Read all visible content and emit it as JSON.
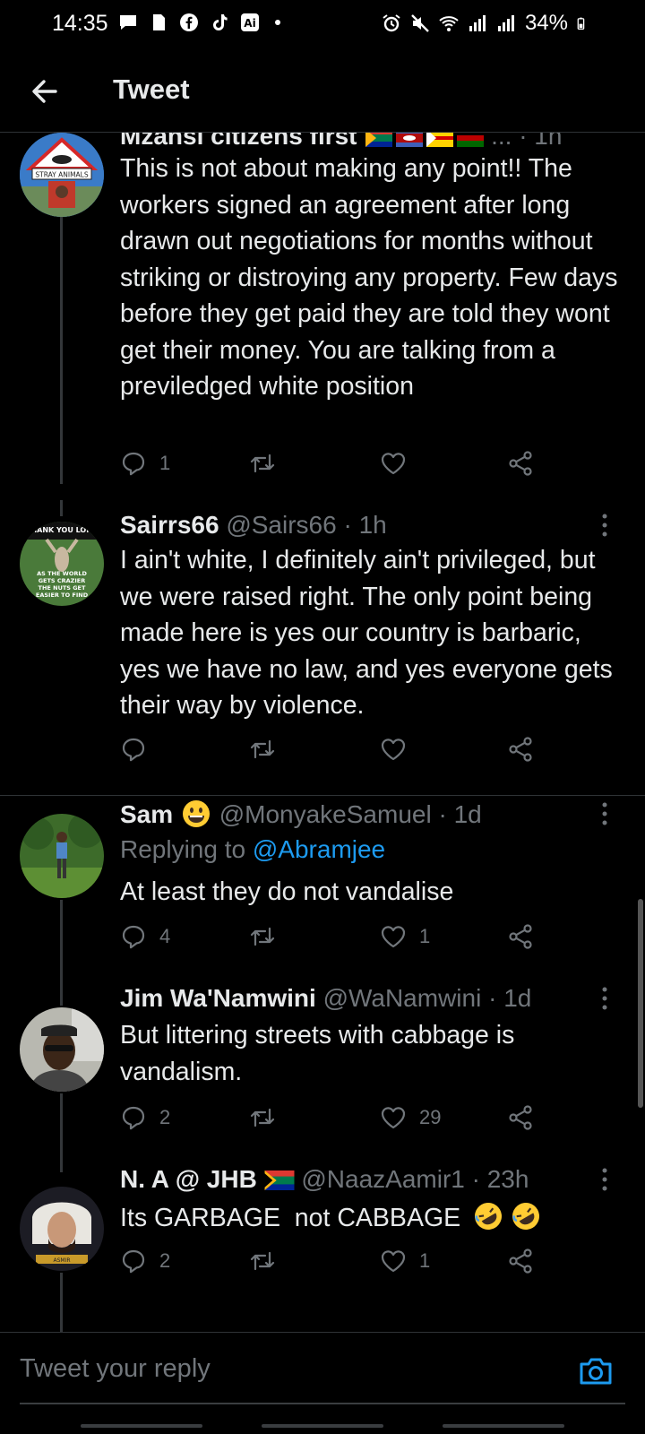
{
  "status_bar": {
    "time": "14:35",
    "battery": "34%"
  },
  "header": {
    "title": "Tweet"
  },
  "tweets": [
    {
      "name": "Mzansi citizens first",
      "meta": "... · 1h",
      "body": "This is not about making any point!! The workers signed an agreement after long drawn out negotiations for months without striking or distroying any property. Few days before they get paid they are told they wont get their money. You are talking from a previledged white position",
      "replies": "1",
      "retweets": "",
      "likes": ""
    },
    {
      "name": "Sairrs66",
      "handle": "@Sairs66",
      "time": "· 1h",
      "body": "I ain't white, I definitely ain't privileged, but we were raised right. The only point being made here is yes our country is barbaric, yes we have no law, and yes everyone gets their way by violence.",
      "replies": "",
      "retweets": "",
      "likes": ""
    },
    {
      "name": "Sam",
      "handle": "@MonyakeSamuel",
      "time": "· 1d",
      "replying_prefix": "Replying to",
      "replying_to": "@Abramjee",
      "body": "At least they do not vandalise",
      "replies": "4",
      "retweets": "",
      "likes": "1"
    },
    {
      "name": "Jim Wa'Namwini",
      "handle": "@WaNamwini",
      "time": "· 1d",
      "body": "But littering streets with cabbage is vandalism.",
      "replies": "2",
      "retweets": "",
      "likes": "29"
    },
    {
      "name": "N. A @ JHB",
      "handle": "@NaazAamir1",
      "time": "· 23h",
      "body": "Its GARBAGE  not CABBAGE",
      "replies": "2",
      "retweets": "",
      "likes": "1"
    }
  ],
  "avatar_texts": {
    "stray_animals": "STRAY ANIMALS",
    "thank_you": "THANK YOU LORD",
    "world_text": "AS THE WORLD GETS CRAZIER THE NUTS GET EASIER TO FIND"
  },
  "reply_bar": {
    "placeholder": "Tweet your reply"
  },
  "colors": {
    "background": "#000000",
    "text": "#e7e9ea",
    "secondary": "#71767b",
    "accent": "#1d9bf0",
    "divider": "#2f3336"
  },
  "icons": [
    "back-arrow-icon",
    "more-icon",
    "reply-icon",
    "retweet-icon",
    "like-icon",
    "share-icon",
    "camera-icon"
  ]
}
